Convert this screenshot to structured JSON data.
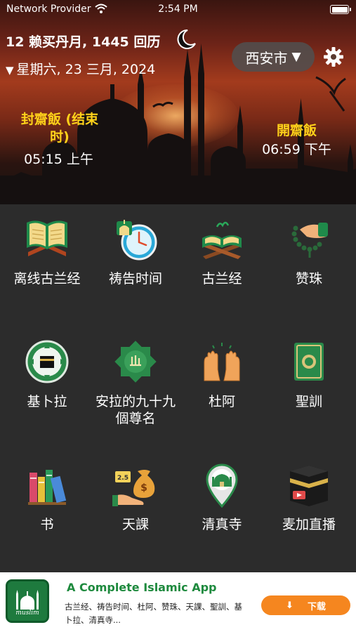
{
  "status_bar": {
    "provider": "Network Provider",
    "time": "2:54 PM"
  },
  "header": {
    "hijri_date": "12 赖买丹月, 1445 回历",
    "gregorian_date": "星期六, 23 三月, 2024",
    "city": "西安市",
    "suhoor_label": "封齋飯 (结束时)",
    "suhoor_time": "05:15 上午",
    "iftar_label": "開齋飯",
    "iftar_time": "06:59 下午"
  },
  "features": [
    {
      "label": "离线古兰经",
      "icon": "quran-book-icon"
    },
    {
      "label": "祷告时间",
      "icon": "prayer-clock-icon"
    },
    {
      "label": "古兰经",
      "icon": "quran-stand-icon"
    },
    {
      "label": "赞珠",
      "icon": "tasbih-icon"
    },
    {
      "label": "基卜拉",
      "icon": "qibla-compass-icon"
    },
    {
      "label": "安拉的九十九個尊名",
      "icon": "allah-names-icon"
    },
    {
      "label": "杜阿",
      "icon": "dua-hands-icon"
    },
    {
      "label": "聖訓",
      "icon": "hadith-book-icon"
    },
    {
      "label": "书",
      "icon": "books-icon"
    },
    {
      "label": "天課",
      "icon": "zakat-icon"
    },
    {
      "label": "清真寺",
      "icon": "mosque-pin-icon"
    },
    {
      "label": "麦加直播",
      "icon": "kaaba-live-icon"
    }
  ],
  "ad": {
    "logo_text": "muslim",
    "title": "A Complete Islamic App",
    "description": "古兰经、祷告时间、杜阿、赞珠、天課、聖訓、基卜拉、清真寺...",
    "button_label": "下载"
  },
  "colors": {
    "accent_yellow": "#ffd21a",
    "grid_bg": "#2c2c2c",
    "ad_green": "#1e8a3e",
    "ad_button": "#f5861f"
  }
}
